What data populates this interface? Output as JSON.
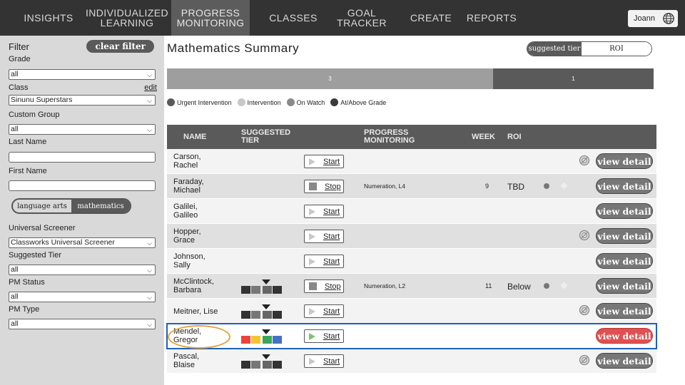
{
  "nav": {
    "items": [
      "INSIGHTS",
      "INDIVIDUALIZED\nLEARNING",
      "PROGRESS\nMONITORING",
      "CLASSES",
      "GOAL TRACKER",
      "CREATE",
      "REPORTS"
    ],
    "user": "Joann"
  },
  "sidebar": {
    "filter_label": "Filter",
    "clear_filter": "clear filter",
    "grade_label": "Grade",
    "grade_value": "all",
    "class_label": "Class",
    "class_edit": "edit",
    "class_value": "Sinunu Superstars",
    "custom_group_label": "Custom Group",
    "custom_group_value": "all",
    "last_name_label": "Last Name",
    "first_name_label": "First Name",
    "subject_options": [
      "language arts",
      "mathematics"
    ],
    "subject_selected": "mathematics",
    "screener_label": "Universal Screener",
    "screener_value": "Classworks Universal Screener",
    "suggested_tier_label": "Suggested Tier",
    "suggested_tier_value": "all",
    "pm_status_label": "PM Status",
    "pm_status_value": "all",
    "pm_type_label": "PM Type",
    "pm_type_value": "all"
  },
  "main": {
    "title": "Mathematics Summary",
    "view_toggle": [
      "suggested tier",
      "ROI"
    ],
    "tier_bar": [
      {
        "label": "3",
        "count_share": 0.67,
        "color": "#9e9e9e"
      },
      {
        "label": "1",
        "count_share": 0.33,
        "color": "#5a5a5a"
      }
    ],
    "legend": [
      {
        "label": "Urgent Intervention",
        "color": "#5a5a5a"
      },
      {
        "label": "Intervention",
        "color": "#c8c8c8"
      },
      {
        "label": "On Watch",
        "color": "#8a8a8a"
      },
      {
        "label": "At/Above Grade",
        "color": "#3a3a3a"
      }
    ],
    "columns": [
      "NAME",
      "SUGGESTED\nTIER",
      "PROGRESS\nMONITORING",
      "WEEK",
      "ROI"
    ],
    "rows": [
      {
        "name": "Carson,\nRachel",
        "tiers": null,
        "pm_action": "Start",
        "pm_type": "",
        "week": "",
        "roi": "",
        "roi_marks": false,
        "ban_icon": true,
        "detail": "view detail",
        "selected": false
      },
      {
        "name": "Faraday,\nMichael",
        "tiers": null,
        "pm_action": "Stop",
        "pm_type": "Numeration, L4",
        "week": "9",
        "roi": "TBD",
        "roi_marks": true,
        "ban_icon": false,
        "detail": "view detail",
        "selected": false
      },
      {
        "name": "Galilei,\nGalileo",
        "tiers": null,
        "pm_action": "Start",
        "pm_type": "",
        "week": "",
        "roi": "",
        "roi_marks": false,
        "ban_icon": false,
        "detail": "view detail",
        "selected": false
      },
      {
        "name": "Hopper,\nGrace",
        "tiers": null,
        "pm_action": "Start",
        "pm_type": "",
        "week": "",
        "roi": "",
        "roi_marks": false,
        "ban_icon": true,
        "detail": "view detail",
        "selected": false
      },
      {
        "name": "Johnson,\nSally",
        "tiers": null,
        "pm_action": "Start",
        "pm_type": "",
        "week": "",
        "roi": "",
        "roi_marks": false,
        "ban_icon": false,
        "detail": "view detail",
        "selected": false
      },
      {
        "name": "McClintock,\nBarbara",
        "tiers": [
          "#333",
          "#777",
          "#666",
          "#333"
        ],
        "pm_action": "Stop",
        "pm_type": "Numeration, L2",
        "week": "11",
        "roi": "Below",
        "roi_marks": true,
        "ban_icon": false,
        "detail": "view detail",
        "selected": false
      },
      {
        "name": "Meitner, Lise",
        "tiers": [
          "#333",
          "#777",
          "#666",
          "#333"
        ],
        "pm_action": "Start",
        "pm_type": "",
        "week": "",
        "roi": "",
        "roi_marks": false,
        "ban_icon": true,
        "detail": "view detail",
        "selected": false
      },
      {
        "name": "Mendel,\nGregor",
        "tiers": [
          "#e8453c",
          "#f4c531",
          "#3aa757",
          "#4272c4"
        ],
        "pm_action": "Start",
        "pm_type": "",
        "week": "",
        "roi": "",
        "roi_marks": false,
        "ban_icon": false,
        "detail": "view detail",
        "selected": true
      },
      {
        "name": "Pascal,\nBlaise",
        "tiers": [
          "#333",
          "#777",
          "#666",
          "#333"
        ],
        "pm_action": "Start",
        "pm_type": "",
        "week": "",
        "roi": "",
        "roi_marks": false,
        "ban_icon": true,
        "detail": "view detail",
        "selected": false
      }
    ]
  }
}
